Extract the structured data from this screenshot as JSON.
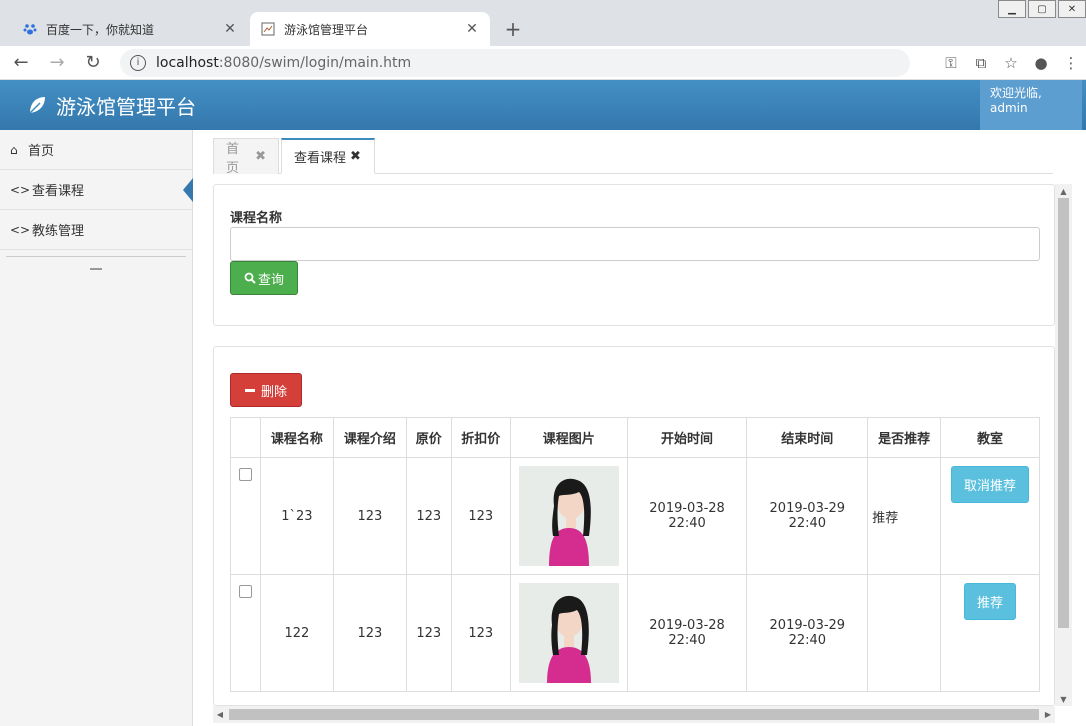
{
  "browser": {
    "tabs": [
      {
        "title": "百度一下，你就知道",
        "close": "✕"
      },
      {
        "title": "游泳馆管理平台",
        "close": "✕"
      }
    ],
    "new_tab": "+",
    "url_host": "localhost",
    "url_rest": ":8080/swim/login/main.htm"
  },
  "header": {
    "brand": "游泳馆管理平台",
    "welcome_line1": "欢迎光临,",
    "welcome_user": "admin"
  },
  "sidebar": {
    "items": [
      {
        "label": "首页",
        "icon": "home-icon"
      },
      {
        "label": "查看课程",
        "icon": "code-icon"
      },
      {
        "label": "教练管理",
        "icon": "code-icon"
      }
    ]
  },
  "content_tabs": [
    {
      "label": "首页",
      "close": "✖"
    },
    {
      "label": "查看课程",
      "close": "✖"
    }
  ],
  "search": {
    "label": "课程名称",
    "value": "",
    "query_button": "查询"
  },
  "list": {
    "delete_button": "删除",
    "columns": [
      "课程名称",
      "课程介绍",
      "原价",
      "折扣价",
      "课程图片",
      "开始时间",
      "结束时间",
      "是否推荐",
      "教室"
    ],
    "rows": [
      {
        "name": "1`23",
        "intro": "123",
        "price": "123",
        "discount": "123",
        "start_date": "2019-03-28",
        "start_time": "22:40",
        "end_date": "2019-03-29",
        "end_time": "22:40",
        "recommended": "推荐",
        "action": "取消推荐"
      },
      {
        "name": "122",
        "intro": "123",
        "price": "123",
        "discount": "123",
        "start_date": "2019-03-28",
        "start_time": "22:40",
        "end_date": "2019-03-29",
        "end_time": "22:40",
        "recommended": "",
        "action": "推荐"
      }
    ]
  },
  "colors": {
    "header": "#3c8dbc",
    "query": "#4cae4c",
    "delete": "#d43f3a",
    "info": "#5bc0de"
  }
}
